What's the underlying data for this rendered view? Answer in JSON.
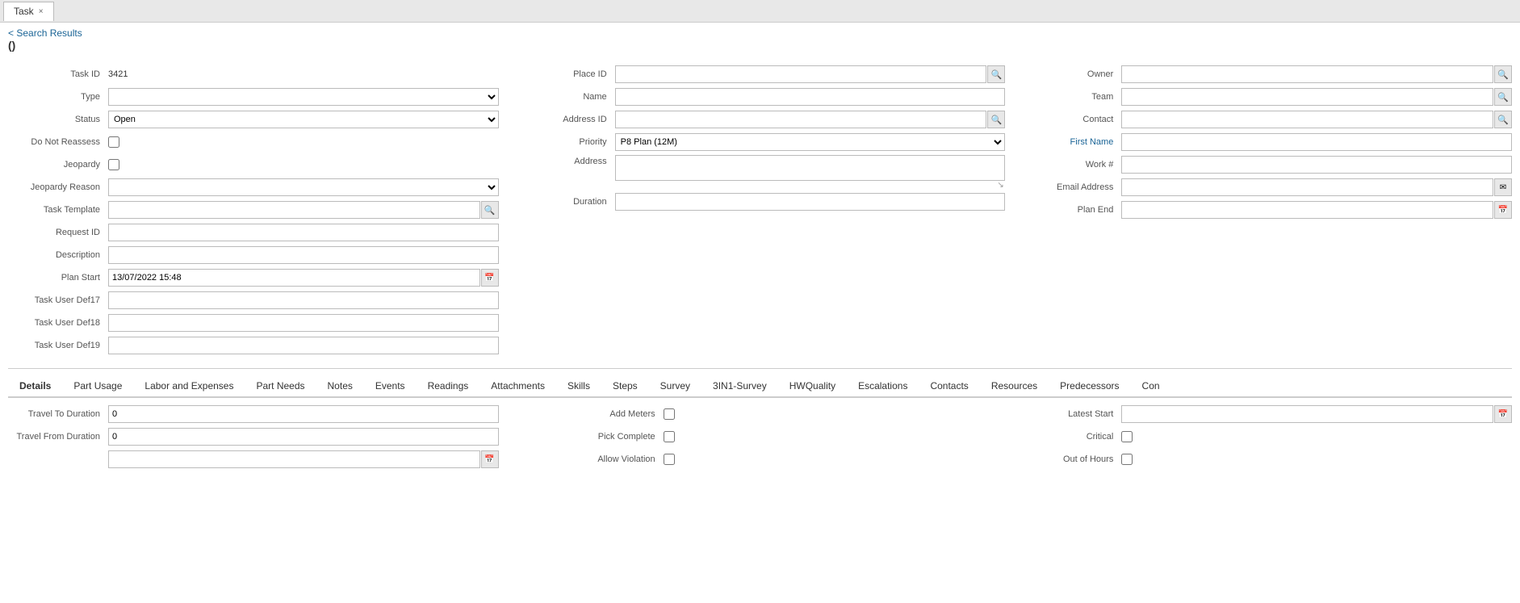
{
  "tab": {
    "label": "Task",
    "close_icon": "×"
  },
  "breadcrumb": {
    "text": "< Search Results"
  },
  "page_title": "()",
  "form": {
    "task_id_label": "Task ID",
    "task_id_value": "3421",
    "type_label": "Type",
    "status_label": "Status",
    "status_value": "Open",
    "do_not_reassess_label": "Do Not Reassess",
    "jeopardy_label": "Jeopardy",
    "jeopardy_reason_label": "Jeopardy Reason",
    "task_template_label": "Task Template",
    "request_id_label": "Request ID",
    "description_label": "Description",
    "plan_start_label": "Plan Start",
    "plan_start_value": "13/07/2022 15:48",
    "duration_label": "Duration",
    "plan_end_label": "Plan End",
    "task_user_def17_label": "Task User Def17",
    "task_user_def18_label": "Task User Def18",
    "task_user_def19_label": "Task User Def19",
    "place_id_label": "Place ID",
    "name_label": "Name",
    "address_id_label": "Address ID",
    "priority_label": "Priority",
    "priority_value": "P8 Plan (12M)",
    "address_label": "Address",
    "owner_label": "Owner",
    "team_label": "Team",
    "contact_label": "Contact",
    "first_name_label": "First Name",
    "work_hash_label": "Work #",
    "email_address_label": "Email Address"
  },
  "bottom_tabs": [
    {
      "id": "details",
      "label": "Details",
      "active": true
    },
    {
      "id": "part-usage",
      "label": "Part Usage",
      "active": false
    },
    {
      "id": "labor-expenses",
      "label": "Labor and Expenses",
      "active": false
    },
    {
      "id": "part-needs",
      "label": "Part Needs",
      "active": false
    },
    {
      "id": "notes",
      "label": "Notes",
      "active": false
    },
    {
      "id": "events",
      "label": "Events",
      "active": false
    },
    {
      "id": "readings",
      "label": "Readings",
      "active": false
    },
    {
      "id": "attachments",
      "label": "Attachments",
      "active": false
    },
    {
      "id": "skills",
      "label": "Skills",
      "active": false
    },
    {
      "id": "steps",
      "label": "Steps",
      "active": false
    },
    {
      "id": "survey",
      "label": "Survey",
      "active": false
    },
    {
      "id": "3in1-survey",
      "label": "3IN1-Survey",
      "active": false
    },
    {
      "id": "hwquality",
      "label": "HWQuality",
      "active": false
    },
    {
      "id": "escalations",
      "label": "Escalations",
      "active": false
    },
    {
      "id": "contacts",
      "label": "Contacts",
      "active": false
    },
    {
      "id": "resources",
      "label": "Resources",
      "active": false
    },
    {
      "id": "predecessors",
      "label": "Predecessors",
      "active": false
    },
    {
      "id": "con",
      "label": "Con",
      "active": false
    }
  ],
  "details_section": {
    "travel_to_duration_label": "Travel To Duration",
    "travel_to_duration_value": "0",
    "travel_from_duration_label": "Travel From Duration",
    "travel_from_duration_value": "0",
    "add_meters_label": "Add Meters",
    "pick_complete_label": "Pick Complete",
    "allow_violation_label": "Allow Violation",
    "latest_start_label": "Latest Start",
    "critical_label": "Critical",
    "out_of_hours_label": "Out of Hours"
  },
  "icons": {
    "search": "🔍",
    "calendar": "📅",
    "email": "✉",
    "resize": "↘",
    "close": "×"
  }
}
